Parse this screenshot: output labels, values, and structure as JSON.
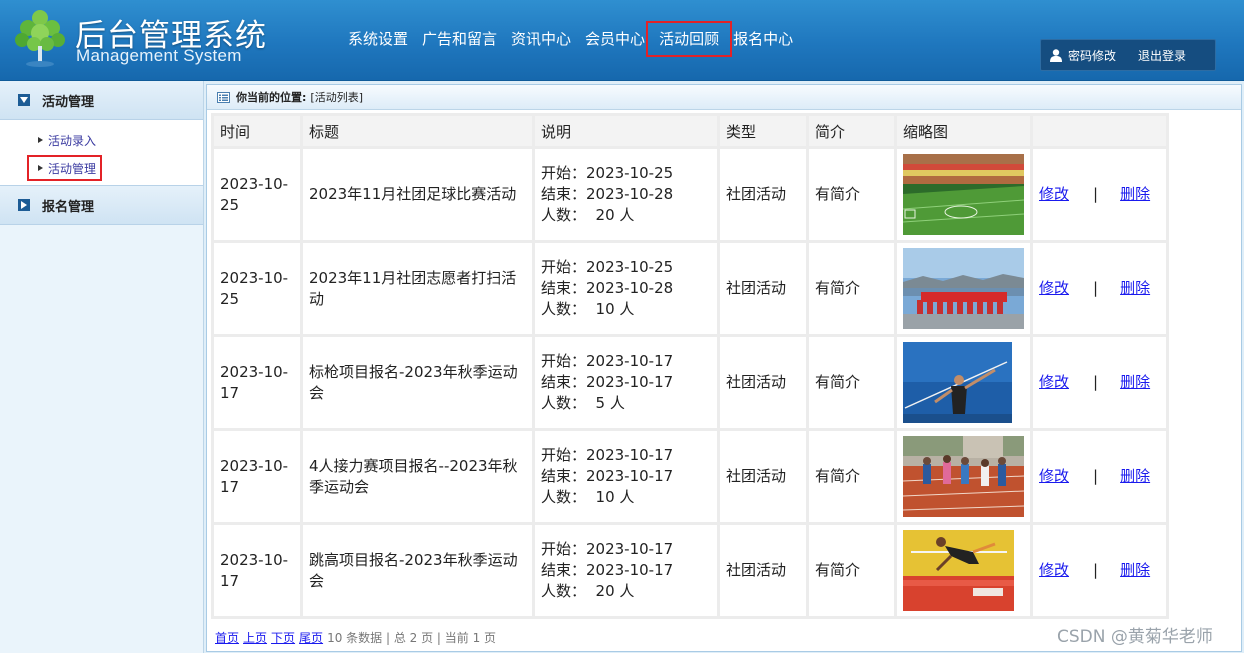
{
  "header": {
    "title": "后台管理系统",
    "subtitle": "Management System",
    "nav": [
      "系统设置",
      "广告和留言",
      "资讯中心",
      "会员中心",
      "活动回顾",
      "报名中心"
    ],
    "change_password": "密码修改",
    "logout": "退出登录"
  },
  "sidebar": {
    "groups": [
      {
        "label": "活动管理",
        "items": [
          "活动录入",
          "活动管理"
        ]
      },
      {
        "label": "报名管理"
      }
    ]
  },
  "breadcrumb": {
    "label": "你当前的位置:",
    "value": "[活动列表]"
  },
  "table": {
    "headers": [
      "时间",
      "标题",
      "说明",
      "类型",
      "简介",
      "缩略图",
      ""
    ],
    "rows": [
      {
        "date": "2023-10-25",
        "title": "2023年11月社团足球比赛活动",
        "start": "开始：2023-10-25",
        "end": "结束：2023-10-28",
        "count": "人数：  20 人",
        "type": "社团活动",
        "intro": "有简介",
        "thumb": "football-stadium"
      },
      {
        "date": "2023-10-25",
        "title": "2023年11月社团志愿者打扫活动",
        "start": "开始：2023-10-25",
        "end": "结束：2023-10-28",
        "count": "人数：  10 人",
        "type": "社团活动",
        "intro": "有简介",
        "thumb": "volunteer-group"
      },
      {
        "date": "2023-10-17",
        "title": "标枪项目报名-2023年秋季运动会",
        "start": "开始：2023-10-17",
        "end": "结束：2023-10-17",
        "count": "人数：  5 人",
        "type": "社团活动",
        "intro": "有简介",
        "thumb": "javelin"
      },
      {
        "date": "2023-10-17",
        "title": "4人接力赛项目报名--2023年秋季运动会",
        "start": "开始：2023-10-17",
        "end": "结束：2023-10-17",
        "count": "人数：  10 人",
        "type": "社团活动",
        "intro": "有简介",
        "thumb": "relay-track"
      },
      {
        "date": "2023-10-17",
        "title": "跳高项目报名-2023年秋季运动会",
        "start": "开始：2023-10-17",
        "end": "结束：2023-10-17",
        "count": "人数：  20 人",
        "type": "社团活动",
        "intro": "有简介",
        "thumb": "high-jump"
      }
    ],
    "edit_label": "修改",
    "separator": "|",
    "delete_label": "删除"
  },
  "pager": {
    "first": "首页",
    "prev": "上页",
    "next": "下页",
    "last": "尾页",
    "info": "10 条数据 | 总 2 页 | 当前 1 页"
  },
  "watermark": "CSDN @黄菊华老师",
  "colors": {
    "header": "#1f77be",
    "highlight": "#e32227",
    "link": "#1a1aee"
  }
}
